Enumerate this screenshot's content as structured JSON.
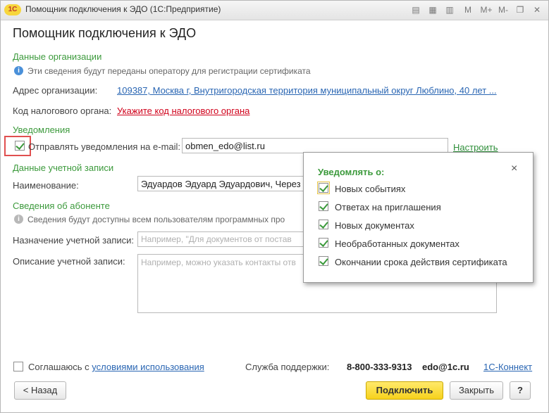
{
  "window": {
    "app_icon": "1C",
    "title": "Помощник подключения к ЭДО  (1С:Предприятие)",
    "toolbar_icons": [
      "doc-icon",
      "calendar-icon",
      "calc-icon"
    ],
    "toolbar_text": [
      "M",
      "M+",
      "M-"
    ]
  },
  "page_title": "Помощник подключения к ЭДО",
  "org": {
    "section": "Данные организации",
    "hint": "Эти сведения будут переданы оператору для регистрации сертификата",
    "address_label": "Адрес организации:",
    "address_value": "109387, Москва г, Внутригородская территория муниципальный округ Люблино, 40 лет ...",
    "tax_label": "Код налогового органа:",
    "tax_value": "Укажите код налогового органа"
  },
  "notifications": {
    "section": "Уведомления",
    "send_label": "Отправлять уведомления на e-mail:",
    "send_checked": true,
    "email": "obmen_edo@list.ru",
    "configure": "Настроить"
  },
  "account": {
    "section": "Данные учетной записи",
    "name_label": "Наименование:",
    "name_value": "Эдуардов Эдуард Эдуардович, Через"
  },
  "subscriber": {
    "section": "Сведения об абоненте",
    "hint": "Сведения будут доступны всем пользователям программных про",
    "purpose_label": "Назначение учетной записи:",
    "purpose_placeholder": "Например, \"Для документов от постав",
    "description_label": "Описание учетной записи:",
    "description_placeholder": "Например, можно указать контакты отв"
  },
  "popup": {
    "title": "Уведомлять о:",
    "options": [
      {
        "label": "Новых событиях",
        "checked": true
      },
      {
        "label": "Ответах на приглашения",
        "checked": true
      },
      {
        "label": "Новых документах",
        "checked": true
      },
      {
        "label": "Необработанных документах",
        "checked": true
      },
      {
        "label": "Окончании срока действия сертификата",
        "checked": true
      }
    ]
  },
  "footer": {
    "agree_prefix": "Соглашаюсь с ",
    "agree_link": "условиями использования",
    "support_label": "Служба поддержки:",
    "phone": "8-800-333-9313",
    "email": "edo@1c.ru",
    "connect_link": "1С-Коннект",
    "back": "< Назад",
    "connect": "Подключить",
    "close": "Закрыть",
    "help": "?"
  }
}
